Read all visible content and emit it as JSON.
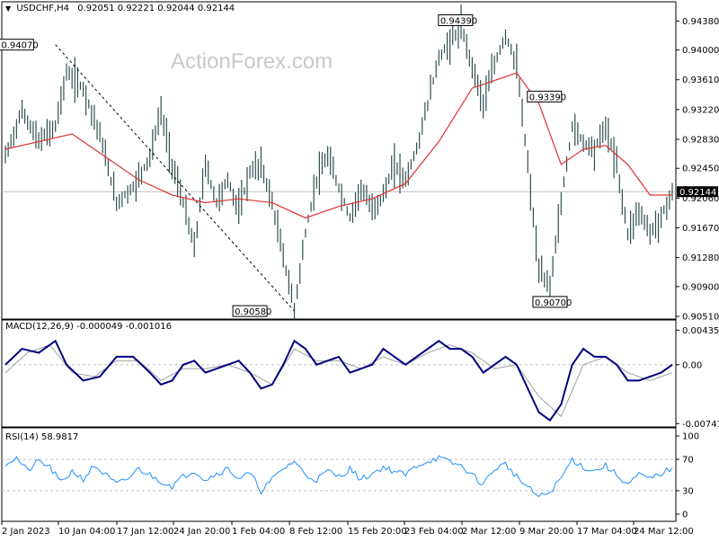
{
  "header": {
    "symbol": "USDCHF,H4",
    "ohlc": "0.92051 0.92221 0.92044 0.92144",
    "dropdown_icon": "triangle-down-icon"
  },
  "watermark": "ActionForex.com",
  "colors": {
    "candles": "#2f4f4f",
    "ma": "#e03030",
    "macd": "#00007f",
    "signal": "#a0a0a0",
    "rsi": "#1e90ff",
    "grid": "#c0c0c0",
    "trendline": "#000000"
  },
  "chart_data": [
    {
      "type": "candlestick",
      "title": "USDCHF,H4",
      "y_ticks": [
        "0.94380",
        "0.94000",
        "0.93610",
        "0.93220",
        "0.92830",
        "0.92450",
        "0.92060",
        "0.91670",
        "0.91280",
        "0.90900",
        "0.90510"
      ],
      "ylim": [
        0.9051,
        0.9449
      ],
      "current_price": "0.92144",
      "annotations": [
        {
          "label": "0.94070",
          "value": 0.9407
        },
        {
          "label": "0.94390",
          "value": 0.9439
        },
        {
          "label": "0.93390",
          "value": 0.9339
        },
        {
          "label": "0.90580",
          "value": 0.9058
        },
        {
          "label": "0.90700",
          "value": 0.907
        }
      ],
      "x_labels": [
        "2 Jan 2023",
        "10 Jan 04:00",
        "17 Jan 12:00",
        "24 Jan 20:00",
        "1 Feb 04:00",
        "8 Feb 12:00",
        "15 Feb 20:00",
        "23 Feb 04:00",
        "2 Mar 12:00",
        "9 Mar 20:00",
        "17 Mar 04:00",
        "24 Mar 12:00"
      ],
      "series": [
        {
          "name": "price",
          "points": [
            [
              0,
              0.926
            ],
            [
              3,
              0.932
            ],
            [
              6,
              0.928
            ],
            [
              9,
              0.93
            ],
            [
              11,
              0.937
            ],
            [
              14,
              0.935
            ],
            [
              17,
              0.929
            ],
            [
              20,
              0.92
            ],
            [
              23,
              0.922
            ],
            [
              26,
              0.926
            ],
            [
              28,
              0.932
            ],
            [
              30,
              0.925
            ],
            [
              32,
              0.92
            ],
            [
              34,
              0.914
            ],
            [
              36,
              0.925
            ],
            [
              38,
              0.92
            ],
            [
              40,
              0.923
            ],
            [
              42,
              0.919
            ],
            [
              44,
              0.924
            ],
            [
              46,
              0.925
            ],
            [
              48,
              0.92
            ],
            [
              50,
              0.913
            ],
            [
              52,
              0.906
            ],
            [
              54,
              0.916
            ],
            [
              56,
              0.923
            ],
            [
              58,
              0.926
            ],
            [
              60,
              0.922
            ],
            [
              62,
              0.918
            ],
            [
              64,
              0.922
            ],
            [
              66,
              0.919
            ],
            [
              68,
              0.921
            ],
            [
              70,
              0.925
            ],
            [
              72,
              0.923
            ],
            [
              74,
              0.927
            ],
            [
              76,
              0.933
            ],
            [
              78,
              0.939
            ],
            [
              80,
              0.941
            ],
            [
              82,
              0.943
            ],
            [
              84,
              0.938
            ],
            [
              86,
              0.933
            ],
            [
              88,
              0.938
            ],
            [
              90,
              0.942
            ],
            [
              92,
              0.938
            ],
            [
              94,
              0.925
            ],
            [
              96,
              0.911
            ],
            [
              98,
              0.909
            ],
            [
              100,
              0.92
            ],
            [
              102,
              0.93
            ],
            [
              104,
              0.928
            ],
            [
              106,
              0.927
            ],
            [
              108,
              0.93
            ],
            [
              110,
              0.925
            ],
            [
              112,
              0.916
            ],
            [
              114,
              0.919
            ],
            [
              116,
              0.916
            ],
            [
              118,
              0.918
            ],
            [
              120,
              0.9214
            ]
          ]
        },
        {
          "name": "ma",
          "points": [
            [
              0,
              0.927
            ],
            [
              6,
              0.928
            ],
            [
              12,
              0.929
            ],
            [
              18,
              0.926
            ],
            [
              24,
              0.923
            ],
            [
              30,
              0.921
            ],
            [
              36,
              0.92
            ],
            [
              42,
              0.9205
            ],
            [
              48,
              0.92
            ],
            [
              54,
              0.918
            ],
            [
              60,
              0.9195
            ],
            [
              66,
              0.9205
            ],
            [
              72,
              0.9225
            ],
            [
              78,
              0.928
            ],
            [
              84,
              0.935
            ],
            [
              88,
              0.936
            ],
            [
              92,
              0.937
            ],
            [
              96,
              0.933
            ],
            [
              100,
              0.925
            ],
            [
              104,
              0.927
            ],
            [
              108,
              0.9275
            ],
            [
              112,
              0.925
            ],
            [
              116,
              0.921
            ],
            [
              120,
              0.921
            ]
          ]
        }
      ]
    },
    {
      "type": "line",
      "title": "MACD(12,26,9) -0.000049 -0.001016",
      "y_ticks": [
        "0.004354",
        "0.00",
        "-0.007417"
      ],
      "ylim": [
        -0.0075,
        0.0045
      ],
      "series": [
        {
          "name": "macd",
          "points": [
            [
              0,
              0.0
            ],
            [
              3,
              0.002
            ],
            [
              6,
              0.0015
            ],
            [
              9,
              0.003
            ],
            [
              11,
              0.0
            ],
            [
              14,
              -0.002
            ],
            [
              17,
              -0.0015
            ],
            [
              20,
              0.001
            ],
            [
              23,
              0.001
            ],
            [
              26,
              -0.001
            ],
            [
              28,
              -0.0025
            ],
            [
              30,
              -0.002
            ],
            [
              32,
              0.0
            ],
            [
              34,
              0.0005
            ],
            [
              36,
              -0.001
            ],
            [
              38,
              -0.0005
            ],
            [
              40,
              0.0
            ],
            [
              42,
              0.0005
            ],
            [
              44,
              -0.001
            ],
            [
              46,
              -0.003
            ],
            [
              48,
              -0.0025
            ],
            [
              50,
              0.0
            ],
            [
              52,
              0.003
            ],
            [
              54,
              0.002
            ],
            [
              56,
              0.0
            ],
            [
              58,
              0.0005
            ],
            [
              60,
              0.001
            ],
            [
              62,
              -0.001
            ],
            [
              64,
              -0.0005
            ],
            [
              66,
              0.0
            ],
            [
              68,
              0.002
            ],
            [
              70,
              0.001
            ],
            [
              72,
              0.0
            ],
            [
              74,
              0.001
            ],
            [
              76,
              0.002
            ],
            [
              78,
              0.003
            ],
            [
              80,
              0.002
            ],
            [
              82,
              0.002
            ],
            [
              84,
              0.001
            ],
            [
              86,
              -0.001
            ],
            [
              88,
              0.0
            ],
            [
              90,
              0.001
            ],
            [
              92,
              0.0
            ],
            [
              94,
              -0.003
            ],
            [
              96,
              -0.006
            ],
            [
              98,
              -0.007
            ],
            [
              100,
              -0.005
            ],
            [
              102,
              0.0
            ],
            [
              104,
              0.002
            ],
            [
              106,
              0.001
            ],
            [
              108,
              0.001
            ],
            [
              110,
              0.0
            ],
            [
              112,
              -0.002
            ],
            [
              114,
              -0.002
            ],
            [
              116,
              -0.0015
            ],
            [
              118,
              -0.001
            ],
            [
              120,
              0.0
            ]
          ]
        },
        {
          "name": "signal",
          "points": [
            [
              0,
              -0.001
            ],
            [
              4,
              0.0015
            ],
            [
              8,
              0.0025
            ],
            [
              12,
              -0.001
            ],
            [
              16,
              -0.0015
            ],
            [
              20,
              0.0005
            ],
            [
              24,
              0.0005
            ],
            [
              28,
              -0.002
            ],
            [
              32,
              -0.0005
            ],
            [
              36,
              -0.0005
            ],
            [
              40,
              0.0
            ],
            [
              44,
              -0.001
            ],
            [
              48,
              -0.0025
            ],
            [
              52,
              0.002
            ],
            [
              56,
              0.0005
            ],
            [
              60,
              0.0005
            ],
            [
              64,
              -0.0005
            ],
            [
              68,
              0.001
            ],
            [
              72,
              0.0
            ],
            [
              76,
              0.0015
            ],
            [
              80,
              0.0025
            ],
            [
              84,
              0.0015
            ],
            [
              88,
              -0.0005
            ],
            [
              92,
              0.0
            ],
            [
              96,
              -0.004
            ],
            [
              100,
              -0.0065
            ],
            [
              104,
              0.0
            ],
            [
              108,
              0.001
            ],
            [
              112,
              -0.001
            ],
            [
              116,
              -0.002
            ],
            [
              120,
              -0.001
            ]
          ]
        }
      ]
    },
    {
      "type": "line",
      "title": "RSI(14) 58.9817",
      "y_ticks": [
        "100",
        "70",
        "30",
        "0"
      ],
      "ylim": [
        0,
        100
      ],
      "series": [
        {
          "name": "rsi",
          "points": [
            [
              0,
              65
            ],
            [
              2,
              72
            ],
            [
              4,
              55
            ],
            [
              6,
              68
            ],
            [
              8,
              60
            ],
            [
              10,
              40
            ],
            [
              12,
              55
            ],
            [
              14,
              45
            ],
            [
              16,
              62
            ],
            [
              18,
              50
            ],
            [
              20,
              38
            ],
            [
              22,
              45
            ],
            [
              24,
              58
            ],
            [
              26,
              50
            ],
            [
              28,
              42
            ],
            [
              30,
              36
            ],
            [
              32,
              48
            ],
            [
              34,
              56
            ],
            [
              36,
              44
            ],
            [
              38,
              52
            ],
            [
              40,
              58
            ],
            [
              42,
              46
            ],
            [
              44,
              52
            ],
            [
              46,
              30
            ],
            [
              48,
              44
            ],
            [
              50,
              58
            ],
            [
              52,
              68
            ],
            [
              54,
              50
            ],
            [
              56,
              44
            ],
            [
              58,
              55
            ],
            [
              60,
              48
            ],
            [
              62,
              58
            ],
            [
              64,
              44
            ],
            [
              66,
              52
            ],
            [
              68,
              60
            ],
            [
              70,
              55
            ],
            [
              72,
              50
            ],
            [
              74,
              62
            ],
            [
              76,
              68
            ],
            [
              78,
              72
            ],
            [
              80,
              66
            ],
            [
              82,
              62
            ],
            [
              84,
              50
            ],
            [
              86,
              38
            ],
            [
              88,
              58
            ],
            [
              90,
              64
            ],
            [
              92,
              48
            ],
            [
              94,
              34
            ],
            [
              96,
              22
            ],
            [
              98,
              28
            ],
            [
              100,
              46
            ],
            [
              102,
              70
            ],
            [
              104,
              60
            ],
            [
              106,
              55
            ],
            [
              108,
              62
            ],
            [
              110,
              50
            ],
            [
              112,
              38
            ],
            [
              114,
              50
            ],
            [
              116,
              45
            ],
            [
              118,
              52
            ],
            [
              120,
              59
            ]
          ]
        }
      ]
    }
  ]
}
